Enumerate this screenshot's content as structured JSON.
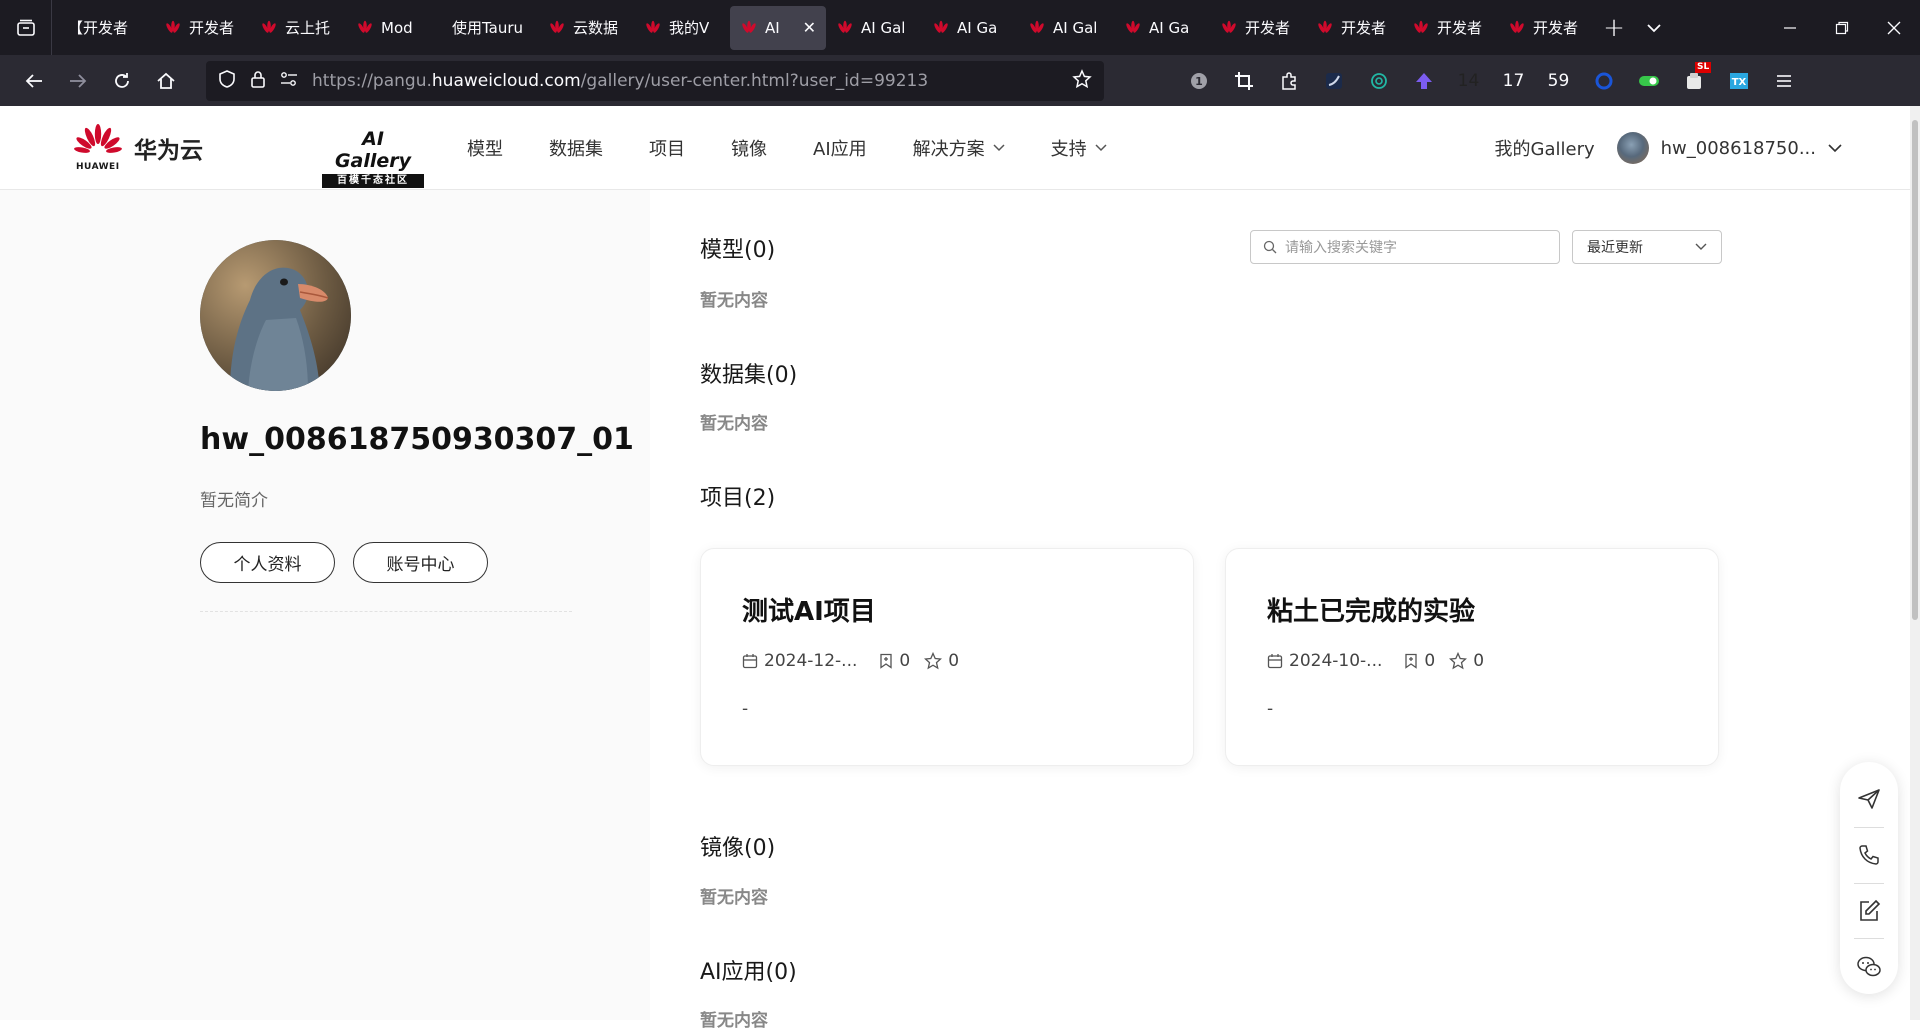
{
  "browser": {
    "tabs": [
      {
        "title": "【开发者",
        "icon": "none"
      },
      {
        "title": "开发者",
        "icon": "huawei-icon"
      },
      {
        "title": "云上托",
        "icon": "huawei-icon"
      },
      {
        "title": "Mod",
        "icon": "huawei-icon"
      },
      {
        "title": "使用Tauru",
        "icon": "none"
      },
      {
        "title": "云数据",
        "icon": "huawei-icon"
      },
      {
        "title": "我的V",
        "icon": "huawei-icon"
      },
      {
        "title": "AI",
        "icon": "huawei-icon",
        "active": true
      },
      {
        "title": "AI Gal",
        "icon": "huawei-icon"
      },
      {
        "title": "AI Ga",
        "icon": "huawei-icon"
      },
      {
        "title": "AI Gal",
        "icon": "huawei-icon"
      },
      {
        "title": "AI Ga",
        "icon": "huawei-icon"
      },
      {
        "title": "开发者",
        "icon": "huawei-icon"
      },
      {
        "title": "开发者",
        "icon": "huawei-icon"
      },
      {
        "title": "开发者",
        "icon": "huawei-icon"
      },
      {
        "title": "开发者",
        "icon": "huawei-icon"
      }
    ],
    "url_prefix": "https://pangu.",
    "url_domain": "huaweicloud.com",
    "url_suffix": "/gallery/user-center.html?user_id=99213",
    "ext_counts": {
      "a": "14",
      "b": "17",
      "c": "59"
    },
    "ext_badge": "SL"
  },
  "header": {
    "brand": "华为云",
    "brand_sub": "HUAWEI",
    "gallery_title": "AI Gallery",
    "gallery_sub": "百模千态社区",
    "nav": [
      "模型",
      "数据集",
      "项目",
      "镜像",
      "AI应用",
      "解决方案",
      "支持"
    ],
    "my_gallery": "我的Gallery",
    "user_name": "hw_008618750..."
  },
  "profile": {
    "username": "hw_008618750930307_01",
    "bio": "暂无简介",
    "btn_profile": "个人资料",
    "btn_account": "账号中心"
  },
  "search": {
    "placeholder": "请输入搜索关键字",
    "sort": "最近更新"
  },
  "sections": {
    "models": {
      "title": "模型(0)",
      "empty": "暂无内容"
    },
    "datasets": {
      "title": "数据集(0)",
      "empty": "暂无内容"
    },
    "projects": {
      "title": "项目(2)"
    },
    "images": {
      "title": "镜像(0)",
      "empty": "暂无内容"
    },
    "apps": {
      "title": "AI应用(0)",
      "empty": "暂无内容"
    }
  },
  "projects": [
    {
      "title": "测试AI项目",
      "date": "2024-12-...",
      "bookmarks": "0",
      "stars": "0",
      "desc": "-"
    },
    {
      "title": "粘土已完成的实验",
      "date": "2024-10-...",
      "bookmarks": "0",
      "stars": "0",
      "desc": "-"
    }
  ]
}
